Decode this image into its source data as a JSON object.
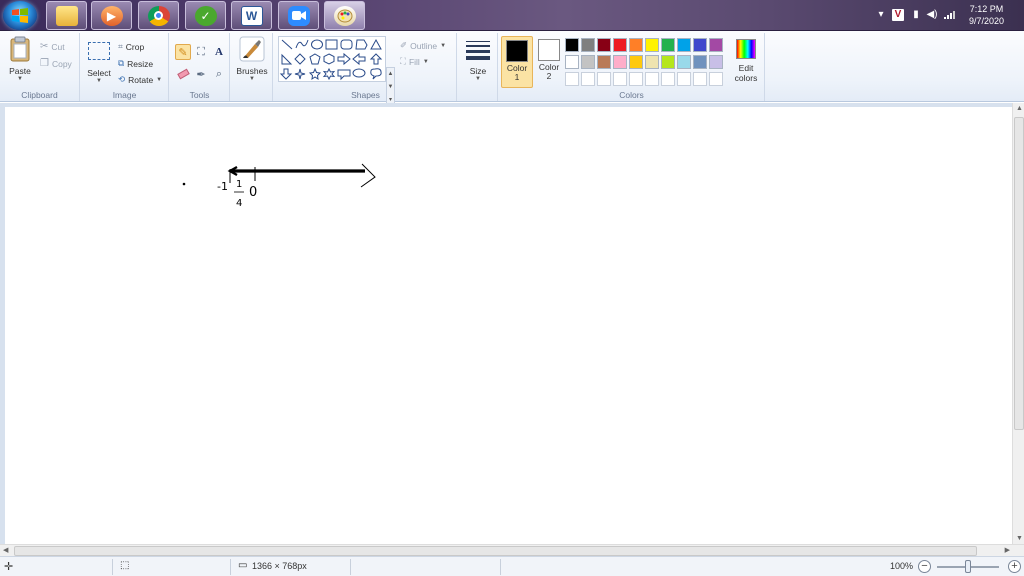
{
  "taskbar": {
    "apps": [
      {
        "name": "file-explorer"
      },
      {
        "name": "media-player"
      },
      {
        "name": "chrome"
      },
      {
        "name": "app-green"
      },
      {
        "name": "word",
        "label": "W"
      },
      {
        "name": "zoom"
      },
      {
        "name": "paint",
        "active": true
      }
    ],
    "tray": {
      "time": "7:12 PM",
      "date": "9/7/2020",
      "tray_letter": "V"
    }
  },
  "ribbon": {
    "clipboard": {
      "paste": "Paste",
      "cut": "Cut",
      "copy": "Copy",
      "label": "Clipboard"
    },
    "image": {
      "select": "Select",
      "crop": "Crop",
      "resize": "Resize",
      "rotate": "Rotate",
      "label": "Image"
    },
    "tools": {
      "label": "Tools",
      "text_tool": "A"
    },
    "brushes": {
      "label": "Brushes"
    },
    "shapes": {
      "outline": "Outline",
      "fill": "Fill",
      "label": "Shapes"
    },
    "size": {
      "label": "Size"
    },
    "colors": {
      "color1": "Color\n1",
      "color1_a": "Color",
      "color1_b": "1",
      "color2_a": "Color",
      "color2_b": "2",
      "color1_value": "#000000",
      "color2_value": "#ffffff",
      "edit_a": "Edit",
      "edit_b": "colors",
      "label": "Colors",
      "palette_row1": [
        "#000000",
        "#7f7f7f",
        "#880015",
        "#ed1c24",
        "#ff7f27",
        "#fff200",
        "#22b14c",
        "#00a2e8",
        "#3f48cc",
        "#a349a4"
      ],
      "palette_row2": [
        "#ffffff",
        "#c3c3c3",
        "#b97a57",
        "#ffaec9",
        "#ffc90e",
        "#efe4b0",
        "#b5e61d",
        "#99d9ea",
        "#7092be",
        "#c8bfe7"
      ],
      "palette_row3": [
        "#ffffff",
        "#ffffff",
        "#ffffff",
        "#ffffff",
        "#ffffff",
        "#ffffff",
        "#ffffff",
        "#ffffff",
        "#ffffff",
        "#ffffff"
      ]
    }
  },
  "canvas": {
    "sketch_labels": {
      "minus_one": "-1",
      "fraction_num": "1",
      "fraction_den": "4",
      "zero": "0"
    }
  },
  "status": {
    "dimensions": "1366 × 768px",
    "zoom": "100%"
  }
}
